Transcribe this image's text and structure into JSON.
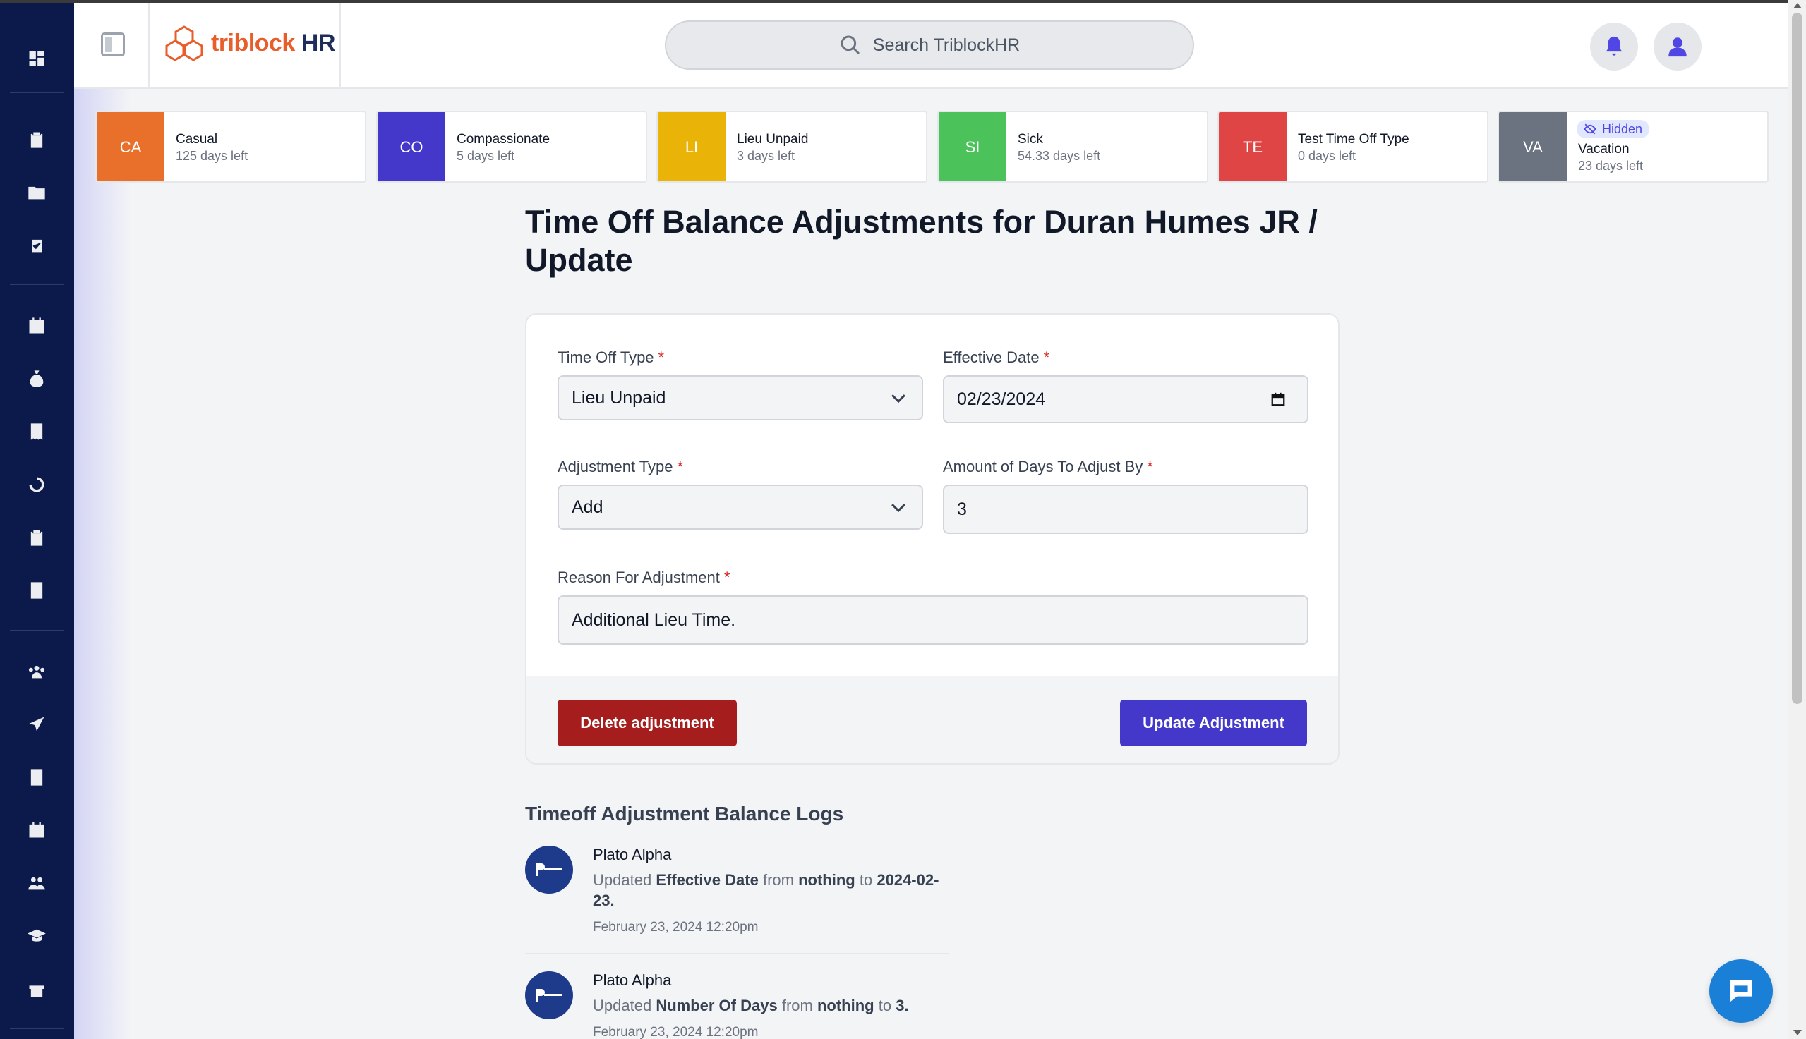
{
  "app": {
    "logo_text": "triblock",
    "logo_suffix": "HR"
  },
  "search": {
    "placeholder": "Search TriblockHR"
  },
  "balances": [
    {
      "code": "CA",
      "name": "Casual",
      "left": "125 days left",
      "color": "#e8702a"
    },
    {
      "code": "CO",
      "name": "Compassionate",
      "left": "5 days left",
      "color": "#4338ca"
    },
    {
      "code": "LI",
      "name": "Lieu Unpaid",
      "left": "3 days left",
      "color": "#eab308"
    },
    {
      "code": "SI",
      "name": "Sick",
      "left": "54.33 days left",
      "color": "#4cc35a"
    },
    {
      "code": "TE",
      "name": "Test Time Off Type",
      "left": "0 days left",
      "color": "#e04545"
    },
    {
      "code": "VA",
      "name": "Vacation",
      "left": "23 days left",
      "color": "#6b7280",
      "badge": "Hidden"
    }
  ],
  "page": {
    "title": "Time Off Balance Adjustments for Duran Humes JR / Update"
  },
  "form": {
    "time_off_type": {
      "label": "Time Off Type",
      "required": "*",
      "value": "Lieu Unpaid"
    },
    "effective_date": {
      "label": "Effective Date",
      "required": "*",
      "value": "02/23/2024"
    },
    "adjustment_type": {
      "label": "Adjustment Type",
      "required": "*",
      "value": "Add"
    },
    "amount": {
      "label": "Amount of Days To Adjust By",
      "required": "*",
      "value": "3"
    },
    "reason": {
      "label": "Reason For Adjustment",
      "required": "*",
      "value": "Additional Lieu Time."
    },
    "delete_label": "Delete adjustment",
    "update_label": "Update Adjustment"
  },
  "logs": {
    "title": "Timeoff Adjustment Balance Logs",
    "items": [
      {
        "user": "Plato Alpha",
        "prefix": "Updated",
        "field": "Effective Date",
        "from_word": "from",
        "from_value": "nothing",
        "to_word": "to",
        "to_value": "2024-02-23.",
        "time": "February 23, 2024 12:20pm"
      },
      {
        "user": "Plato Alpha",
        "prefix": "Updated",
        "field": "Number Of Days",
        "from_word": "from",
        "from_value": "nothing",
        "to_word": "to",
        "to_value": "3.",
        "time": "February 23, 2024 12:20pm"
      }
    ]
  },
  "icons": {
    "rail": [
      "dashboard-icon",
      "clipboard-icon",
      "folder-icon",
      "task-icon",
      "calendar-icon",
      "money-bag-icon",
      "receipt-icon",
      "history-icon",
      "clipboard-list-icon",
      "calculator-icon",
      "team-icon",
      "plane-icon",
      "contact-book-icon",
      "calendar-grid-icon",
      "users-icon",
      "graduation-cap-icon",
      "gift-icon"
    ]
  }
}
